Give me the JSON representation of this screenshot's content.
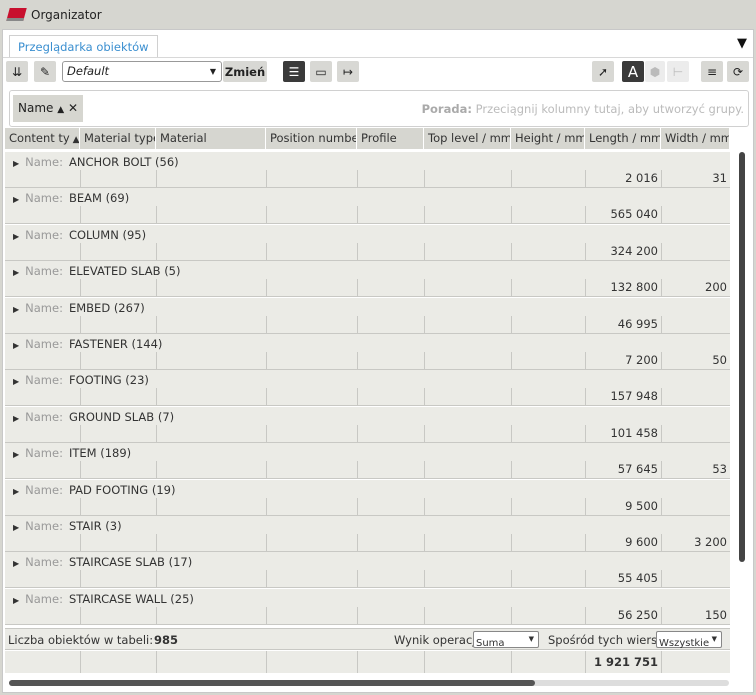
{
  "window": {
    "title": "Organizator"
  },
  "tabs": [
    {
      "label": "Przeglądarka obiektów"
    }
  ],
  "toolbar": {
    "view_select": "Default",
    "change_label": "Zmień",
    "text_mode_label": "A"
  },
  "group_panel": {
    "chip_label": "Name",
    "hint_bold": "Porada:",
    "hint_text": " Przeciągnij kolumny tutaj, aby utworzyć grupy."
  },
  "columns": [
    "Content ty",
    "Material type",
    "Material",
    "Position number",
    "Profile",
    "Top level / mm",
    "Height / mm",
    "Length / mm",
    "Width / mm"
  ],
  "row_label": "Name:",
  "rows": [
    {
      "name": "ANCHOR BOLT (56)",
      "length": "2 016",
      "width": "31"
    },
    {
      "name": "BEAM (69)",
      "length": "565 040",
      "width": ""
    },
    {
      "name": "COLUMN (95)",
      "length": "324 200",
      "width": ""
    },
    {
      "name": "ELEVATED SLAB (5)",
      "length": "132 800",
      "width": "200"
    },
    {
      "name": "EMBED (267)",
      "length": "46 995",
      "width": ""
    },
    {
      "name": "FASTENER (144)",
      "length": "7 200",
      "width": "50"
    },
    {
      "name": "FOOTING (23)",
      "length": "157 948",
      "width": ""
    },
    {
      "name": "GROUND SLAB (7)",
      "length": "101 458",
      "width": ""
    },
    {
      "name": "ITEM (189)",
      "length": "57 645",
      "width": "53"
    },
    {
      "name": "PAD FOOTING (19)",
      "length": "9 500",
      "width": ""
    },
    {
      "name": "STAIR (3)",
      "length": "9 600",
      "width": "3 200"
    },
    {
      "name": "STAIRCASE SLAB (17)",
      "length": "55 405",
      "width": ""
    },
    {
      "name": "STAIRCASE WALL (25)",
      "length": "56 250",
      "width": "150"
    }
  ],
  "footer": {
    "count_label": "Liczba obiektów w tabeli:",
    "count": "985",
    "operation_label": "Wynik operacji:",
    "operation_value": "Suma",
    "rows_label": "Spośród tych wierszy:",
    "rows_value": "Wszystkie"
  },
  "totals": {
    "length": "1 921 751"
  },
  "scroll": {
    "horizontal_fraction": 0.73
  }
}
